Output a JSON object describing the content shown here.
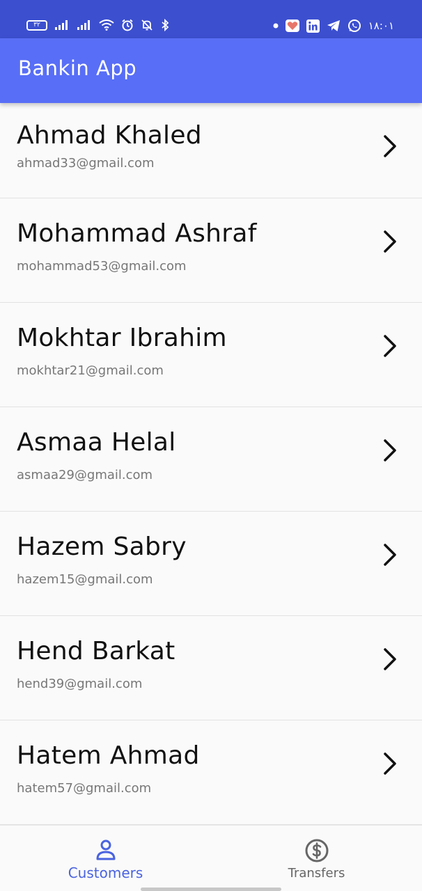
{
  "status_bar": {
    "battery_level": "٣٢",
    "time": "١٨:٠١",
    "left_icons": [
      "battery-icon",
      "signal-icon",
      "signal-icon",
      "wifi-icon",
      "alarm-icon",
      "bell-off-icon",
      "bluetooth-icon"
    ],
    "right_icons": [
      "dot-icon",
      "heart-icon",
      "linkedin-icon",
      "telegram-icon",
      "whatsapp-icon"
    ]
  },
  "app_bar": {
    "title": "Bankin App"
  },
  "customers": [
    {
      "name": "Ahmad Khaled",
      "email": "ahmad33@gmail.com"
    },
    {
      "name": "Mohammad Ashraf",
      "email": "mohammad53@gmail.com"
    },
    {
      "name": "Mokhtar Ibrahim",
      "email": "mokhtar21@gmail.com"
    },
    {
      "name": "Asmaa Helal",
      "email": "asmaa29@gmail.com"
    },
    {
      "name": "Hazem Sabry",
      "email": "hazem15@gmail.com"
    },
    {
      "name": "Hend Barkat",
      "email": "hend39@gmail.com"
    },
    {
      "name": "Hatem Ahmad",
      "email": "hatem57@gmail.com"
    }
  ],
  "bottom_nav": {
    "items": [
      {
        "label": "Customers",
        "icon": "person-icon",
        "active": true
      },
      {
        "label": "Transfers",
        "icon": "dollar-circle-icon",
        "active": false
      }
    ]
  },
  "colors": {
    "status_bar": "#3c4fcf",
    "app_bar": "#586ef6",
    "active_nav": "#4a63e0"
  }
}
